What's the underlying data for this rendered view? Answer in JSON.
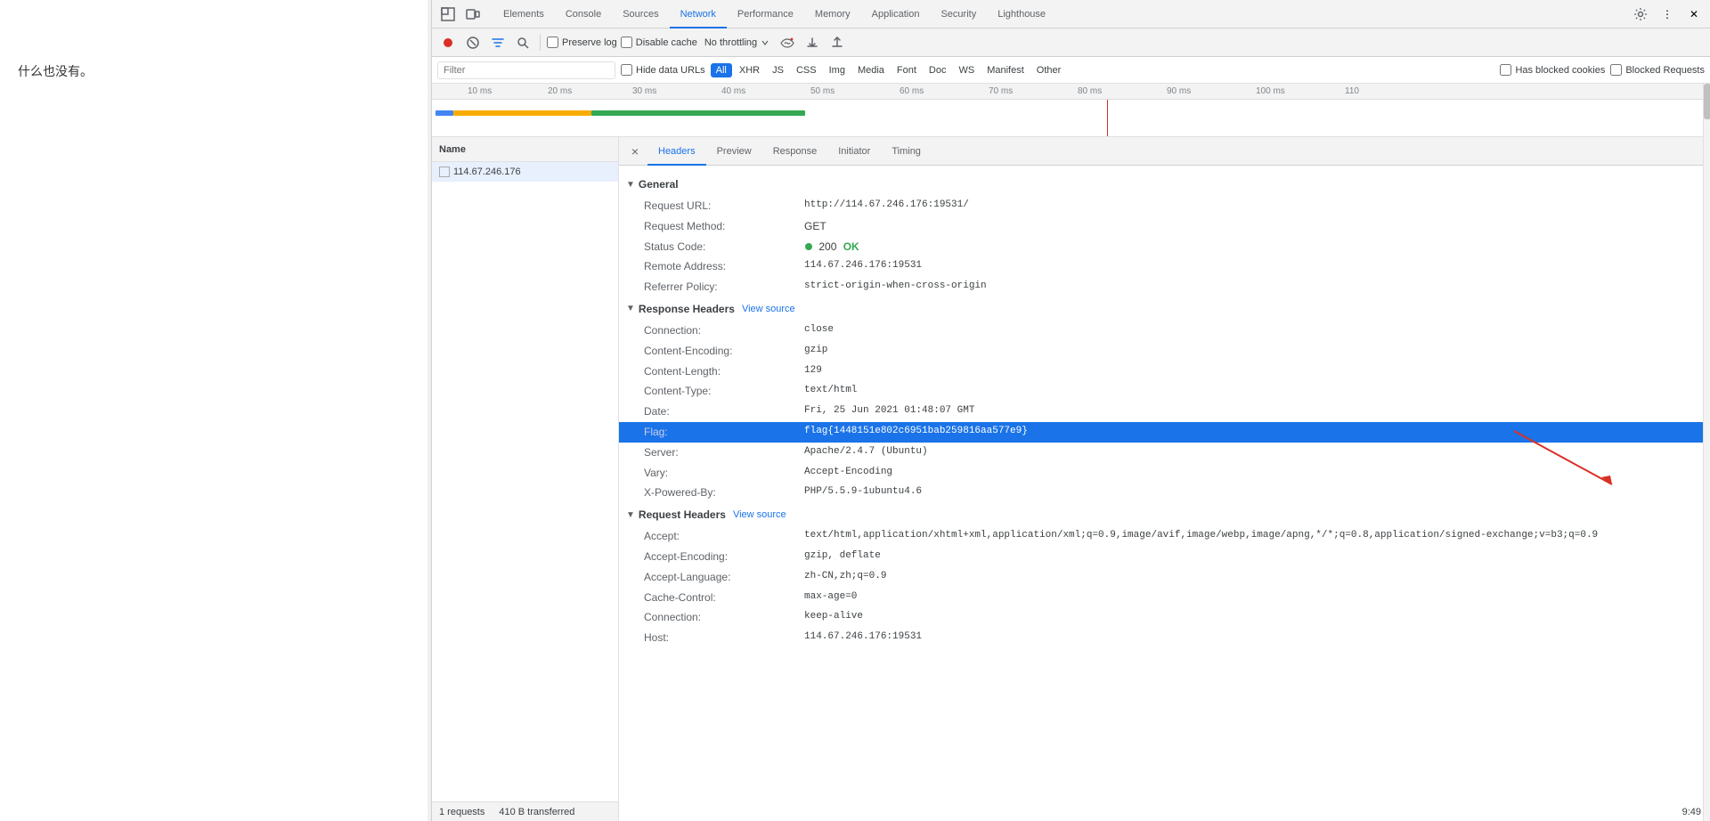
{
  "page": {
    "main_text": "什么也没有。"
  },
  "tabs": {
    "items": [
      {
        "label": "Elements",
        "active": false
      },
      {
        "label": "Console",
        "active": false
      },
      {
        "label": "Sources",
        "active": false
      },
      {
        "label": "Network",
        "active": true
      },
      {
        "label": "Performance",
        "active": false
      },
      {
        "label": "Memory",
        "active": false
      },
      {
        "label": "Application",
        "active": false
      },
      {
        "label": "Security",
        "active": false
      },
      {
        "label": "Lighthouse",
        "active": false
      }
    ]
  },
  "toolbar": {
    "preserve_log": "Preserve log",
    "disable_cache": "Disable cache",
    "no_throttling": "No throttling"
  },
  "filter_bar": {
    "placeholder": "Filter",
    "hide_data_urls": "Hide data URLs",
    "has_blocked_cookies": "Has blocked cookies",
    "blocked_requests": "Blocked Requests",
    "types": [
      "All",
      "XHR",
      "JS",
      "CSS",
      "Img",
      "Media",
      "Font",
      "Doc",
      "WS",
      "Manifest",
      "Other"
    ]
  },
  "timeline": {
    "ticks": [
      "10 ms",
      "20 ms",
      "30 ms",
      "40 ms",
      "50 ms",
      "60 ms",
      "70 ms",
      "80 ms",
      "90 ms",
      "100 ms",
      "110"
    ]
  },
  "name_panel": {
    "header": "Name",
    "items": [
      {
        "name": "114.67.246.176",
        "selected": true
      }
    ]
  },
  "status_footer": {
    "requests": "1 requests",
    "transferred": "410 B transferred"
  },
  "details": {
    "close_label": "×",
    "tabs": [
      "Headers",
      "Preview",
      "Response",
      "Initiator",
      "Timing"
    ],
    "active_tab": "Headers",
    "general": {
      "title": "General",
      "request_url_label": "Request URL:",
      "request_url_value": "http://114.67.246.176:19531/",
      "request_method_label": "Request Method:",
      "request_method_value": "GET",
      "status_code_label": "Status Code:",
      "status_code_value": "200",
      "status_ok": "OK",
      "remote_address_label": "Remote Address:",
      "remote_address_value": "114.67.246.176:19531",
      "referrer_policy_label": "Referrer Policy:",
      "referrer_policy_value": "strict-origin-when-cross-origin"
    },
    "response_headers": {
      "title": "Response Headers",
      "view_source": "View source",
      "items": [
        {
          "name": "Connection:",
          "value": "close"
        },
        {
          "name": "Content-Encoding:",
          "value": "gzip"
        },
        {
          "name": "Content-Length:",
          "value": "129"
        },
        {
          "name": "Content-Type:",
          "value": "text/html"
        },
        {
          "name": "Date:",
          "value": "Fri, 25 Jun 2021 01:48:07 GMT"
        },
        {
          "name": "Flag:",
          "value": "flag{1448151e802c6951bab259816aa577e9}",
          "highlighted": true
        },
        {
          "name": "Server:",
          "value": "Apache/2.4.7 (Ubuntu)"
        },
        {
          "name": "Vary:",
          "value": "Accept-Encoding"
        },
        {
          "name": "X-Powered-By:",
          "value": "PHP/5.5.9-1ubuntu4.6"
        }
      ]
    },
    "request_headers": {
      "title": "Request Headers",
      "view_source": "View source",
      "items": [
        {
          "name": "Accept:",
          "value": "text/html,application/xhtml+xml,application/xml;q=0.9,image/avif,image/webp,image/apng,*/*;q=0.8,application/signed-exchange;v=b3;q=0.9"
        },
        {
          "name": "Accept-Encoding:",
          "value": "gzip, deflate"
        },
        {
          "name": "Accept-Language:",
          "value": "zh-CN,zh;q=0.9"
        },
        {
          "name": "Cache-Control:",
          "value": "max-age=0"
        },
        {
          "name": "Connection:",
          "value": "keep-alive"
        },
        {
          "name": "Host:",
          "value": "114.67.246.176:19531"
        }
      ]
    }
  },
  "clock": "9:49"
}
